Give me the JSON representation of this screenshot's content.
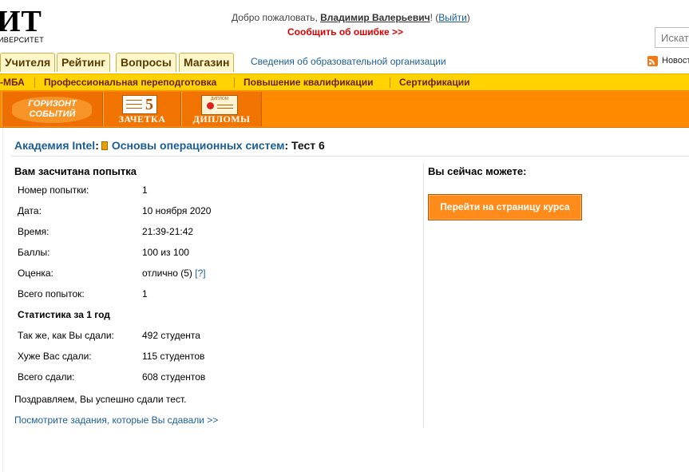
{
  "logo": {
    "text": "ИТ",
    "subtitle": "ИВЕРСИТЕТ"
  },
  "header": {
    "welcome_prefix": "Добро пожаловать, ",
    "user_name": "Владимир Валерьевич",
    "welcome_excl": "! (",
    "logout": "Выйти",
    "close_paren": ")",
    "report_error": "Сообщить об ошибке >>",
    "search_placeholder": "Искать"
  },
  "tabs": [
    "Учителя",
    "Рейтинг",
    "Вопросы",
    "Магазин"
  ],
  "svedenia": "Сведения об образовательной организации",
  "news": "Новост",
  "yellow_nav": [
    "-МБА",
    "Профессиональная переподготовка",
    "Повышение квалификации",
    "Сертификации"
  ],
  "orange_nav": {
    "horizon_line1": "ГОРИЗОНТ",
    "horizon_line2": "СОБЫТИЙ",
    "zachetka_grade": "5",
    "zachetka": "ЗАЧЕТКА",
    "diploma_mini": "ДИПЛОМ",
    "diplomas": "ДИПЛОМЫ"
  },
  "breadcrumb": {
    "academy": "Академия Intel",
    "sep": ":",
    "course": "Основы операционных систем",
    "test": ": Тест 6"
  },
  "result": {
    "heading": "Вам засчитана попытка",
    "rows": [
      {
        "label": "Номер попытки:",
        "value": "1"
      },
      {
        "label": "Дата:",
        "value": "10 ноября 2020"
      },
      {
        "label": "Время:",
        "value": "21:39-21:42"
      },
      {
        "label": "Баллы:",
        "value": "100 из 100"
      },
      {
        "label": "Оценка:",
        "value": "отлично (5)",
        "help": "[?]"
      },
      {
        "label": "Всего попыток:",
        "value": "1"
      }
    ],
    "stats_heading": "Статистика за 1 год",
    "stats": [
      {
        "label": "Так же, как Вы сдали:",
        "value": "492 студента"
      },
      {
        "label": "Хуже Вас сдали:",
        "value": "115 студентов"
      },
      {
        "label": "Всего сдали:",
        "value": "608 студентов"
      }
    ],
    "congrats": "Поздравляем, Вы успешно сдали тест.",
    "view_link": "Посмотрите задания, которые Вы сдавали >>"
  },
  "actions": {
    "heading": "Вы сейчас можете:",
    "course_button": "Перейти на страницу курса"
  }
}
